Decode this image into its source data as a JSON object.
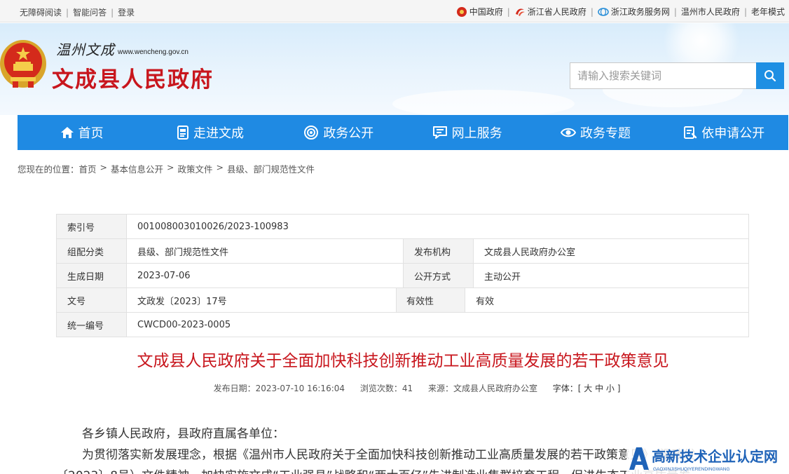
{
  "topbar": {
    "left": [
      "无障碍阅读",
      "智能问答",
      "登录"
    ],
    "right": [
      "中国政府",
      "浙江省人民政府",
      "浙江政务服务网",
      "温州市人民政府",
      "老年模式"
    ]
  },
  "header": {
    "script": "温州文成",
    "domain": "www.wencheng.gov.cn",
    "title": "文成县人民政府",
    "search_placeholder": "请输入搜索关键词"
  },
  "nav": [
    "首页",
    "走进文成",
    "政务公开",
    "网上服务",
    "政务专题",
    "依申请公开"
  ],
  "breadcrumb": {
    "prefix": "您现在的位置：",
    "items": [
      "首页",
      "基本信息公开",
      "政策文件",
      "县级、部门规范性文件"
    ]
  },
  "info": {
    "index_label": "索引号",
    "index_value": "001008003010026/2023-100983",
    "category_label": "组配分类",
    "category_value": "县级、部门规范性文件",
    "publisher_label": "发布机构",
    "publisher_value": "文成县人民政府办公室",
    "date_label": "生成日期",
    "date_value": "2023-07-06",
    "mode_label": "公开方式",
    "mode_value": "主动公开",
    "docno_label": "文号",
    "docno_value": "文政发〔2023〕17号",
    "validity_label": "有效性",
    "validity_value": "有效",
    "code_label": "统一编号",
    "code_value": "CWCD00-2023-0005"
  },
  "article": {
    "title": "文成县人民政府关于全面加快科技创新推动工业高质量发展的若干政策意见",
    "meta": {
      "publish": "发布日期：2023-07-10 16:16:04",
      "views": "浏览次数：41",
      "source": "来源：文成县人民政府办公室",
      "font": "字体：[ 大 中 小 ]"
    },
    "p1": "各乡镇人民政府，县政府直属各单位：",
    "p2": "为贯彻落实新发展理念，根据《温州市人民政府关于全面加快科技创新推动工业高质量发展的若干政策意见》（温政发",
    "p3": "〔2023〕8号）文件精神，加快实施文成“工业强县”战略和“两大百亿”先进制造业集群培育工程，促进生态工业高质量发"
  },
  "watermark": {
    "text": "高新技术企业认定网",
    "sub": "GAOXINJISHUQIYERENDINGWANG"
  },
  "colors": {
    "brand_red": "#c8161d",
    "nav_blue": "#1f8ae3",
    "search_blue": "#1e8fe3"
  }
}
